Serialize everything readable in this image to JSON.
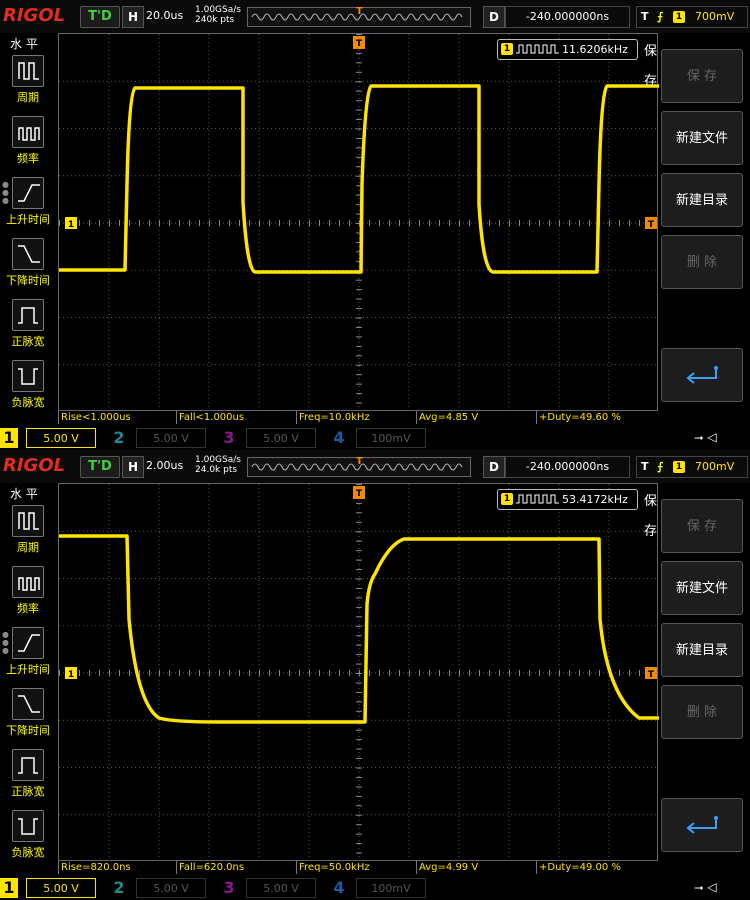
{
  "screens": [
    {
      "logo": "RIGOL",
      "trig_status": "T'D",
      "timebase_label": "H",
      "timebase": "20.0us",
      "sample_rate": "1.00GSa/s",
      "mem_depth": "240k pts",
      "delay_label": "D",
      "delay": "-240.000000ns",
      "trigger": {
        "label": "T",
        "channel": "1",
        "level": "700mV"
      },
      "left_menu": {
        "title": "水 平",
        "items": [
          "周期",
          "频率",
          "上升时间",
          "下降时间",
          "正脉宽",
          "负脉宽"
        ]
      },
      "right_menu": {
        "title": "保存",
        "buttons": [
          "保 存",
          "新建文件",
          "新建目录",
          "删 除"
        ]
      },
      "freq_counter": {
        "channel": "1",
        "value": "11.6206kHz"
      },
      "measurements": [
        "Rise<1.000us",
        "Fall<1.000us",
        "Freq=10.0kHz",
        "Avg=4.85 V",
        "+Duty=49.60 %"
      ],
      "channels": [
        {
          "num": "1",
          "scale": "5.00 V",
          "color": "#ffe400"
        },
        {
          "num": "2",
          "scale": "5.00 V",
          "color": "#1a8a8a"
        },
        {
          "num": "3",
          "scale": "5.00 V",
          "color": "#8a1a8a"
        },
        {
          "num": "4",
          "scale": "100mV",
          "color": "#1a5aa0"
        }
      ],
      "ch1_marker": "1",
      "trig_marker": "T"
    },
    {
      "logo": "RIGOL",
      "trig_status": "T'D",
      "timebase_label": "H",
      "timebase": "2.00us",
      "sample_rate": "1.00GSa/s",
      "mem_depth": "24.0k pts",
      "delay_label": "D",
      "delay": "-240.000000ns",
      "trigger": {
        "label": "T",
        "channel": "1",
        "level": "700mV"
      },
      "left_menu": {
        "title": "水 平",
        "items": [
          "周期",
          "频率",
          "上升时间",
          "下降时间",
          "正脉宽",
          "负脉宽"
        ]
      },
      "right_menu": {
        "title": "保存",
        "buttons": [
          "保 存",
          "新建文件",
          "新建目录",
          "删 除"
        ]
      },
      "freq_counter": {
        "channel": "1",
        "value": "53.4172kHz"
      },
      "measurements": [
        "Rise=820.0ns",
        "Fall=620.0ns",
        "Freq=50.0kHz",
        "Avg=4.99 V",
        "+Duty=49.00 %"
      ],
      "channels": [
        {
          "num": "1",
          "scale": "5.00 V",
          "color": "#ffe400"
        },
        {
          "num": "2",
          "scale": "5.00 V",
          "color": "#1a8a8a"
        },
        {
          "num": "3",
          "scale": "5.00 V",
          "color": "#8a1a8a"
        },
        {
          "num": "4",
          "scale": "100mV",
          "color": "#1a5aa0"
        }
      ],
      "ch1_marker": "1",
      "trig_marker": "T"
    }
  ],
  "colors": {
    "trace": "#ffe400",
    "grid": "#5a5a5a",
    "trigger": "#f08a00"
  }
}
